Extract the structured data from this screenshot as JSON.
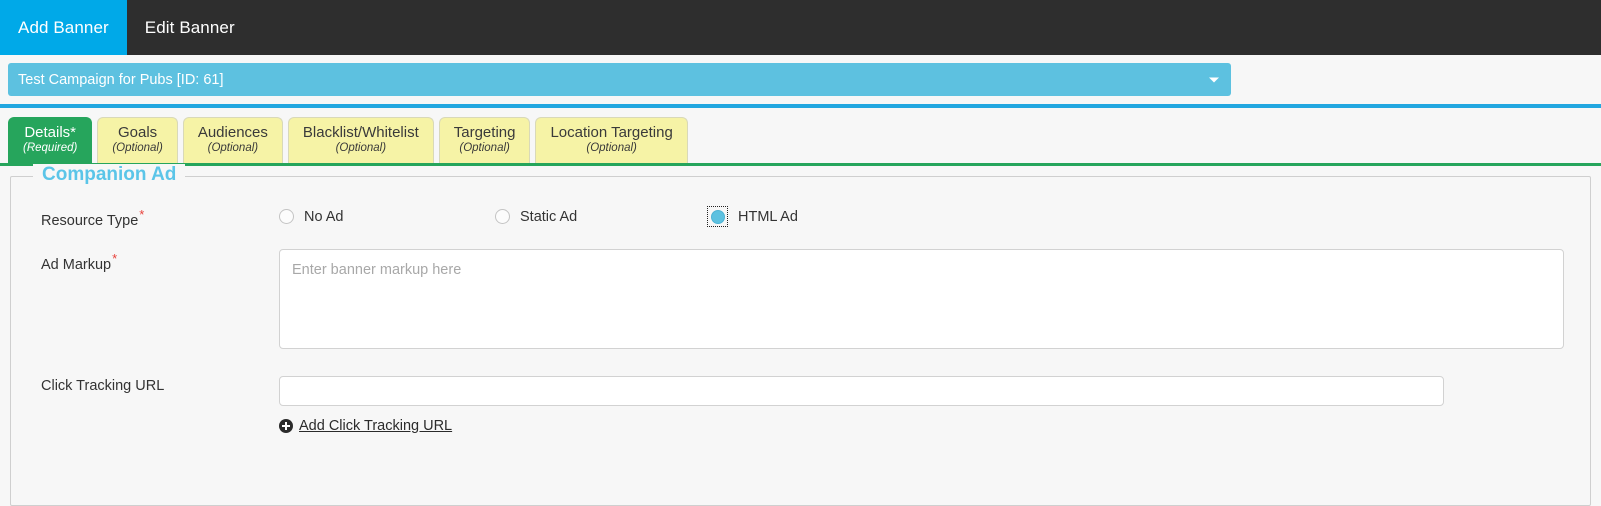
{
  "topnav": {
    "tabs": [
      {
        "label": "Add Banner",
        "active": true
      },
      {
        "label": "Edit Banner",
        "active": false
      }
    ]
  },
  "campaign_selector": {
    "value": "Test Campaign for Pubs [ID: 61]",
    "caret_icon": "chevron-down-icon"
  },
  "wizard_tabs": [
    {
      "title": "Details",
      "required_marker": "*",
      "sub": "(Required)",
      "active": true
    },
    {
      "title": "Goals",
      "required_marker": "",
      "sub": "(Optional)",
      "active": false
    },
    {
      "title": "Audiences",
      "required_marker": "",
      "sub": "(Optional)",
      "active": false
    },
    {
      "title": "Blacklist/Whitelist",
      "required_marker": "",
      "sub": "(Optional)",
      "active": false
    },
    {
      "title": "Targeting",
      "required_marker": "",
      "sub": "(Optional)",
      "active": false
    },
    {
      "title": "Location Targeting",
      "required_marker": "",
      "sub": "(Optional)",
      "active": false
    }
  ],
  "panel": {
    "legend": "Companion Ad",
    "resource_type": {
      "label": "Resource Type",
      "required_marker": "*",
      "options": [
        {
          "label": "No Ad",
          "selected": false
        },
        {
          "label": "Static Ad",
          "selected": false
        },
        {
          "label": "HTML Ad",
          "selected": true
        }
      ]
    },
    "ad_markup": {
      "label": "Ad Markup",
      "required_marker": "*",
      "placeholder": "Enter banner markup here",
      "value": ""
    },
    "click_tracking_url": {
      "label": "Click Tracking URL",
      "placeholder": "",
      "value": ""
    },
    "add_click_tracking": {
      "label": "Add Click Tracking URL",
      "icon": "plus-circle-icon"
    }
  },
  "colors": {
    "nav_active": "#00a9e8",
    "nav_bg": "#2e2e2e",
    "campaign_bar": "#5dc1e0",
    "blue_rule": "#22a7e0",
    "tab_active_green": "#26a55c",
    "tab_optional_yellow": "#f6f3a6",
    "legend_blue": "#5bc5e8",
    "required_red": "#e8403a"
  }
}
